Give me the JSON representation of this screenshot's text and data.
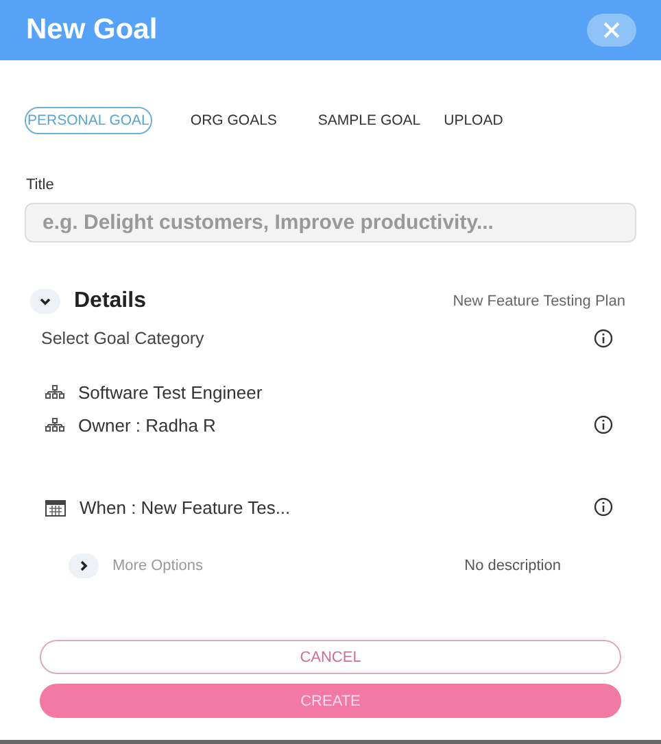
{
  "header": {
    "title": "New Goal"
  },
  "tabs": [
    {
      "label": "PERSONAL GOAL",
      "selected": true
    },
    {
      "label": "ORG GOALS",
      "selected": false
    },
    {
      "label": "SAMPLE GOAL",
      "selected": false
    },
    {
      "label": "UPLOAD",
      "selected": false
    }
  ],
  "title_field": {
    "label": "Title",
    "placeholder": "e.g. Delight customers, Improve productivity..."
  },
  "details": {
    "label": "Details",
    "expanded": true,
    "plan": "New Feature Testing Plan",
    "category_label": "Select Goal Category",
    "items": [
      {
        "kind": "org",
        "text": "Software Test Engineer",
        "info": false
      },
      {
        "kind": "org",
        "text": "Owner : Radha R",
        "info": true
      },
      {
        "kind": "calendar",
        "text": "When : New Feature Tes...",
        "info": true
      }
    ]
  },
  "more_options": {
    "label": "More Options",
    "expanded": false,
    "description": "No description"
  },
  "buttons": {
    "cancel": "CANCEL",
    "create": "CREATE"
  }
}
